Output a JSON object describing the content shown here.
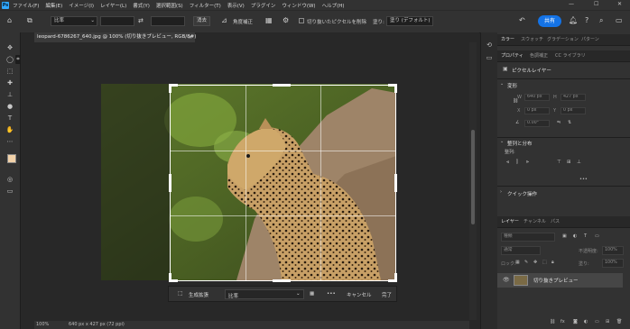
{
  "menubar": {
    "logo": "Ps",
    "items": [
      "ファイル(F)",
      "編集(E)",
      "イメージ(I)",
      "レイヤー(L)",
      "書式(Y)",
      "選択範囲(S)",
      "フィルター(T)",
      "表示(V)",
      "プラグイン",
      "ウィンドウ(W)",
      "ヘルプ(H)"
    ],
    "minimize": "—",
    "maximize": "☐",
    "close": "✕"
  },
  "options": {
    "ratio_select": "比率",
    "swap_icon": "⇄",
    "clear_label": "消去",
    "straighten_label": "角度補正",
    "delete_cropped_label": "切り抜いたピクセルを削除",
    "fill_label": "塗り:",
    "fill_select": "塗り (デフォルト)",
    "share_label": "共有"
  },
  "document": {
    "tab_title": "leopard-6786267_640.jpg @ 100% (切り抜きプレビュー, RGB/8#)",
    "tab_close": "×",
    "zoom": "100%",
    "size_info": "640 px x 427 px (72 ppi)"
  },
  "crop_toolbar": {
    "generative_fill": "生成拡張",
    "ratio": "比率",
    "more": "•••",
    "cancel": "キャンセル",
    "done": "完了"
  },
  "panels": {
    "top_tabs": [
      "カラー",
      "スウォッチ",
      "グラデーション",
      "パターン"
    ],
    "prop_tabs": [
      "プロパティ",
      "色調補正",
      "CC ライブラリ"
    ],
    "pixel_layer": "ピクセルレイヤー",
    "transform_title": "変形",
    "w_label": "W",
    "w_value": "640 px",
    "h_label": "H",
    "h_value": "427 px",
    "x_label": "X",
    "x_value": "0 px",
    "y_label": "Y",
    "y_value": "0 px",
    "angle_value": "0.00°",
    "align_title": "整列と分布",
    "align_label": "整列:",
    "more": "•••",
    "quick_actions_title": "クイック操作",
    "layer_tabs": [
      "レイヤー",
      "チャンネル",
      "パス"
    ],
    "search_placeholder": "種類",
    "blend_mode": "通常",
    "opacity_label": "不透明度:",
    "opacity_value": "100%",
    "lock_label": "ロック:",
    "fill_label": "塗り:",
    "fill_value": "100%",
    "layer_name": "切り抜きプレビュー"
  },
  "colors": {
    "accent": "#1473e6",
    "foreground": "#f2d2a9",
    "background": "#ffffff"
  }
}
